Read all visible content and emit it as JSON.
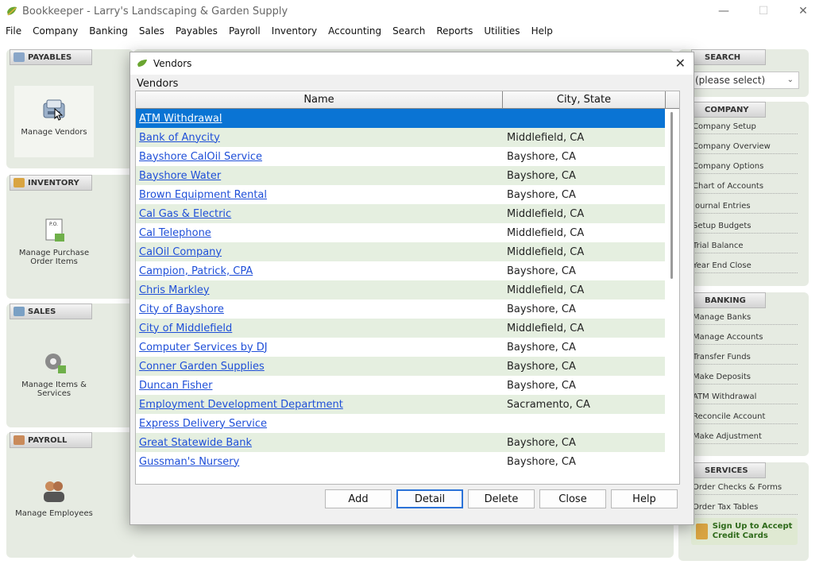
{
  "window": {
    "title": "Bookkeeper - Larry's Landscaping & Garden Supply",
    "minimize": "—",
    "maximize": "☐",
    "close": "✕"
  },
  "menu": [
    "File",
    "Company",
    "Banking",
    "Sales",
    "Payables",
    "Payroll",
    "Inventory",
    "Accounting",
    "Search",
    "Reports",
    "Utilities",
    "Help"
  ],
  "left_panels": {
    "payables": {
      "tab": "PAYABLES",
      "icon_label": "Manage Vendors"
    },
    "inventory": {
      "tab": "INVENTORY",
      "icon_label": "Manage Purchase Order Items",
      "icon_text": "P.O."
    },
    "sales": {
      "tab": "SALES",
      "icon_label": "Manage Items & Services"
    },
    "payroll": {
      "tab": "PAYROLL",
      "icon_label": "Manage Employees"
    }
  },
  "right_panels": {
    "search": {
      "tab": "SEARCH",
      "select_value": "(please select)"
    },
    "company": {
      "tab": "COMPANY",
      "links": [
        "Company Setup",
        "Company Overview",
        "Company Options",
        "Chart of Accounts",
        "Journal Entries",
        "Setup Budgets",
        "Trial Balance",
        "Year End Close"
      ]
    },
    "banking": {
      "tab": "BANKING",
      "links": [
        "Manage Banks",
        "Manage Accounts",
        "Transfer Funds",
        "Make Deposits",
        "ATM Withdrawal",
        "Reconcile Account",
        "Make Adjustment"
      ]
    },
    "services": {
      "tab": "SERVICES",
      "links": [
        "Order Checks & Forms",
        "Order Tax Tables"
      ],
      "promo": "Sign Up to Accept Credit Cards"
    }
  },
  "dialog": {
    "title": "Vendors",
    "label": "Vendors",
    "columns": {
      "name": "Name",
      "city": "City, State"
    },
    "selected_index": 0,
    "vendors": [
      {
        "name": "ATM Withdrawal",
        "city": ""
      },
      {
        "name": "Bank of Anycity",
        "city": "Middlefield, CA"
      },
      {
        "name": "Bayshore CalOil Service",
        "city": "Bayshore, CA"
      },
      {
        "name": "Bayshore Water",
        "city": "Bayshore, CA"
      },
      {
        "name": "Brown Equipment Rental",
        "city": "Bayshore, CA"
      },
      {
        "name": "Cal Gas & Electric",
        "city": "Middlefield, CA"
      },
      {
        "name": "Cal Telephone",
        "city": "Middlefield, CA"
      },
      {
        "name": "CalOil Company",
        "city": "Middlefield, CA"
      },
      {
        "name": "Campion, Patrick, CPA",
        "city": "Bayshore, CA"
      },
      {
        "name": "Chris Markley",
        "city": "Middlefield, CA"
      },
      {
        "name": "City of Bayshore",
        "city": "Bayshore, CA"
      },
      {
        "name": "City of Middlefield",
        "city": "Middlefield, CA"
      },
      {
        "name": "Computer Services by DJ",
        "city": "Bayshore, CA"
      },
      {
        "name": "Conner Garden Supplies",
        "city": "Bayshore, CA"
      },
      {
        "name": "Duncan Fisher",
        "city": "Bayshore, CA"
      },
      {
        "name": "Employment Development Department",
        "city": "Sacramento, CA"
      },
      {
        "name": "Express Delivery Service",
        "city": ""
      },
      {
        "name": "Great Statewide Bank",
        "city": "Bayshore, CA"
      },
      {
        "name": "Gussman's Nursery",
        "city": "Bayshore, CA"
      }
    ],
    "buttons": {
      "add": "Add",
      "detail": "Detail",
      "delete": "Delete",
      "close": "Close",
      "help": "Help"
    }
  }
}
